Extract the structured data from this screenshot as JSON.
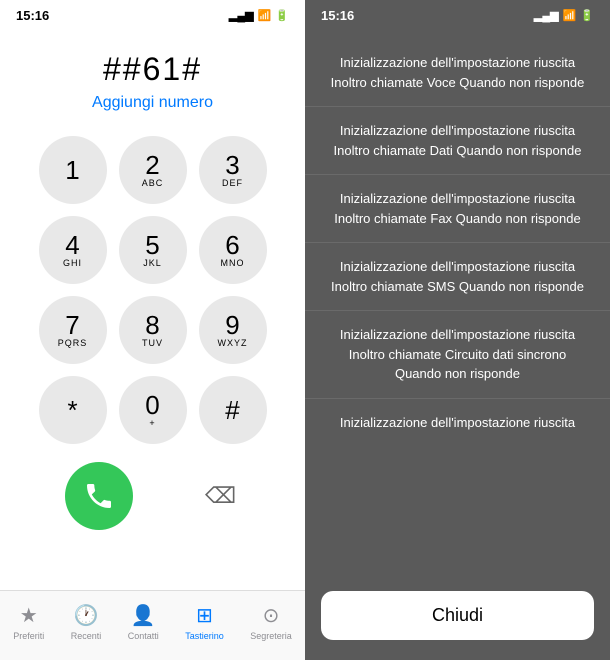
{
  "left": {
    "status_time": "15:16",
    "dial_code": "##61#",
    "add_number_label": "Aggiungi numero",
    "keys": [
      {
        "num": "1",
        "sub": ""
      },
      {
        "num": "2",
        "sub": "ABC"
      },
      {
        "num": "3",
        "sub": "DEF"
      },
      {
        "num": "4",
        "sub": "GHI"
      },
      {
        "num": "5",
        "sub": "JKL"
      },
      {
        "num": "6",
        "sub": "MNO"
      },
      {
        "num": "7",
        "sub": "PQRS"
      },
      {
        "num": "8",
        "sub": "TUV"
      },
      {
        "num": "9",
        "sub": "WXYZ"
      },
      {
        "num": "*",
        "sub": ""
      },
      {
        "num": "0",
        "sub": "+"
      },
      {
        "num": "#",
        "sub": ""
      }
    ],
    "nav_items": [
      {
        "label": "Preferiti",
        "icon": "★",
        "active": false
      },
      {
        "label": "Recenti",
        "icon": "🕐",
        "active": false
      },
      {
        "label": "Contatti",
        "icon": "👤",
        "active": false
      },
      {
        "label": "Tastierino",
        "icon": "⊞",
        "active": true
      },
      {
        "label": "Segreteria",
        "icon": "⊙",
        "active": false
      }
    ]
  },
  "right": {
    "status_time": "15:16",
    "results": [
      "Inizializzazione dell'impostazione riuscita\nInoltro chiamate Voce\nQuando non risponde",
      "Inizializzazione dell'impostazione riuscita\nInoltro chiamate Dati\nQuando non risponde",
      "Inizializzazione dell'impostazione riuscita\nInoltro chiamate Fax\nQuando non risponde",
      "Inizializzazione dell'impostazione riuscita\nInoltro chiamate SMS\nQuando non risponde",
      "Inizializzazione dell'impostazione riuscita\nInoltro chiamate Circuito dati sincrono\nQuando non risponde",
      "Inizializzazione dell'impostazione riuscita"
    ],
    "close_label": "Chiudi"
  }
}
